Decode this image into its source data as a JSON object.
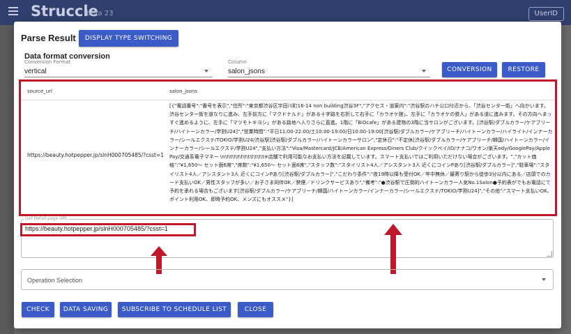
{
  "app": {
    "title": "Struccle",
    "beta": "beta 23",
    "user_button": "UserID"
  },
  "modal": {
    "title": "Parse Result",
    "display_switch_label": "DISPLAY TYPE SWITCHING",
    "section_title": "Data format conversion",
    "conversion_format": {
      "label": "Conversion Format",
      "value": "vertical"
    },
    "column": {
      "label": "Column",
      "value": "salon_jsons"
    },
    "conversion_button": "CONVERSION",
    "restore_button": "RESTORE",
    "table": {
      "headers": [
        "source_url",
        "salon_jsons"
      ],
      "row": {
        "source_url": "https://beauty.hotpepper.jp/slnH000705485/?csst=1",
        "salon_jsons": "[{\"電話番号\":\"番号を表示\",\"住所\":\"東京都渋谷区宇田川町16-14 non building渋谷3F\",\"アクセス・道案内\":\"渋谷駅のハチ公口付近から、「渋谷センター街」へ向かいます。渋谷センター街を道なりに進み、左手前方に「マクドナルド」がある十字路を右折して右手に「カラオケ館」、左手に「カラオケの鉄人」がある道に進みます。その方向へまっすぐ進めるように、左手に「マツモトキヨシ」がある路地へ入りさらに直進。1階に「BiOcafe」がある建物の3階に当サロンがございます。[渋谷駅/ダブルカラー/ケアブリーチ/ハイトーンカラー/学割U24]\",\"営業時間\":\"平日11:00-22:00/土10:00-19:00/日10:00-19:00[渋谷駅/ダブルカラー/ケアブリーチ/ハイトーンカラー/ハイライト/インナーカラー/シールエクステ/TOKIO/学割U24/渋谷駅]渋谷駅/ダブルカラー/ハイトーンカラーサロン\",\"定休日\":\"不定休[渋谷駅/ダブルカラー/ケアブリーチ/韓国/ハイトーンカラー/インナーカラー/シールエクステ/学割U24\",\"支払い方法\":\"Visa/Mastercard/JCB/American Express/Diners Club/クイックペイ/iD/ナナコ/ワオン/楽天edy/GooglePay/ApplePay/交通系電子マネー \\n\\t\\t\\t\\t\\t\\t\\t\\t\\t\\t\\t※店舗で利用可能なお支払い方法を記載しています。スマート支払いではご利用いただけない場合がございます。\",\"カット価格\":\"¥1,650～ セット面6席\",\"席数\":\"¥1,650～ セット面6席\",\"スタッフ数\":\"スタイリスト4人／アシスタント3人 近くにコインPあり[渋谷駅/ダブルカラー]\",\"駐車場\":\"スタイリスト4人／アシスタント3人 近くにコインPあり[渋谷駅/ダブルカラー]\",\"こだわり条件\":\"夜19時以降も受付OK／年中無休／最寄り駅から徒歩3分以内にある／店頭でのカード支払いOK／男性スタッフが多い／お子さま同伴OK／禁煙／ドリンクサービスあり\",\"備考\":\"●渋谷駅で圧倒的ハイトーンカラー人気No.1Salon●予約表がでもお電話にて予約を承れる場合もございます[渋谷駅/ダブルカラー/ケアブリーチ/韓国/ハイトーンカラー/インナーカラー/シールエクステ/TOKIO/学割U24]\",\"その他\":\"スマート支払いOK、ポイント利用OK、即時予約OK、メンズにもオススメ\"}]"
      }
    },
    "url_field": {
      "label": "Get Detail page URL",
      "value": "https://beauty.hotpepper.jp/slnH000705485/?csst=1"
    },
    "operation_selection": "Operation Selection",
    "buttons": {
      "check": "CHECK",
      "data_saving": "DATA SAVING",
      "subscribe": "SUBSCRIBE TO SCHEDULE LIST",
      "close": "CLOSE"
    }
  },
  "colors": {
    "primary_button": "#3b5bc8",
    "highlight_red": "#c0182a",
    "appbar": "#303f6e"
  }
}
